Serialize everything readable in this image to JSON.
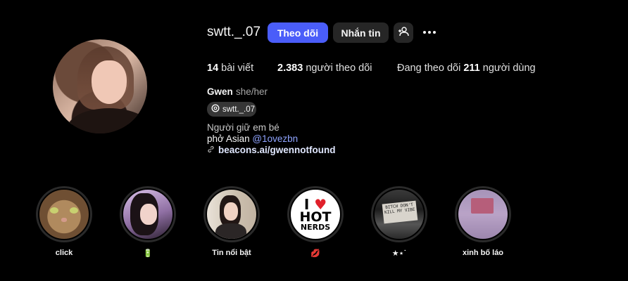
{
  "profile": {
    "username": "swtt._.07",
    "full_name": "Gwen",
    "pronouns": "she/her",
    "threads_handle": "swtt._.07",
    "bio_line1": "Người giữ em bé",
    "bio_line2_prefix": "phở Asian ",
    "bio_mention": "@1ovezbn",
    "link_text": "beacons.ai/gwennotfound"
  },
  "actions": {
    "follow_label": "Theo dõi",
    "message_label": "Nhắn tin",
    "suggest_icon": "+",
    "more_icon": "more-options-icon"
  },
  "stats": {
    "posts_count": "14",
    "posts_label": "bài viết",
    "followers_count": "2.383",
    "followers_label": "người theo dõi",
    "following_prefix": "Đang theo dõi",
    "following_count": "211",
    "following_label": "người dùng"
  },
  "highlights": [
    {
      "label": "click"
    },
    {
      "label": "🔋"
    },
    {
      "label": "Tin nổi bật"
    },
    {
      "label": "💋"
    },
    {
      "label": "★⋆˙"
    },
    {
      "label": "xinh bố láo"
    }
  ],
  "highlight_art": {
    "hot_row1_i": "I",
    "hot_row1_heart": "♥",
    "hot_row2": "HOT",
    "hot_row3": "NERDS",
    "sign_text": "BITCH DON'T KILL MY VIBE"
  },
  "colors": {
    "background": "#000000",
    "follow_button": "#4a5df9",
    "secondary_button": "#262626",
    "mention_link": "#8fa4ff"
  }
}
